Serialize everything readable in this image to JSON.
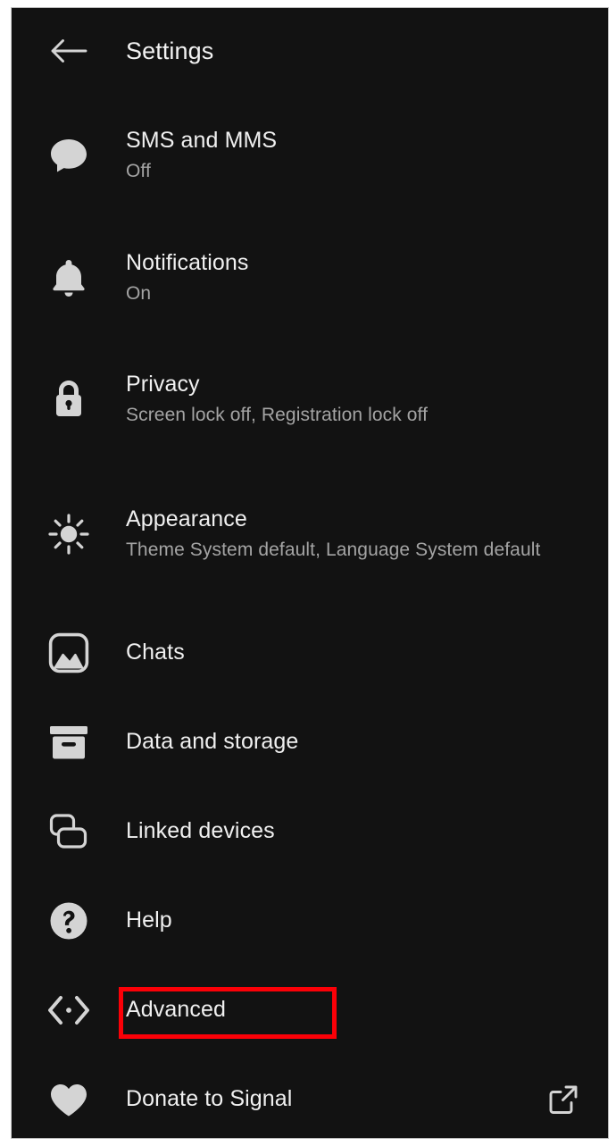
{
  "app": "Signal",
  "header": {
    "title": "Settings",
    "back_icon": "arrow-left-icon"
  },
  "theme": {
    "background": "#121212",
    "title_color": "#f0f0f0",
    "subtitle_color": "#a4a4a4",
    "icon_color": "#d4d4d4",
    "highlight_color": "#fb0007"
  },
  "highlight": {
    "target": "Advanced",
    "color": "#fb0007"
  },
  "settings": {
    "items": [
      {
        "id": "sms-and-mms",
        "label": "SMS and MMS",
        "value": "Off",
        "icon": "chat-bubble-icon",
        "trailing": null
      },
      {
        "id": "notifications",
        "label": "Notifications",
        "value": "On",
        "icon": "bell-icon",
        "trailing": null
      },
      {
        "id": "privacy",
        "label": "Privacy",
        "value": "Screen lock off, Registration lock off",
        "icon": "lock-icon",
        "trailing": null
      },
      {
        "id": "appearance",
        "label": "Appearance",
        "value": "Theme System default, Language System default",
        "icon": "sun-icon",
        "trailing": null
      },
      {
        "id": "chats",
        "label": "Chats",
        "value": null,
        "icon": "image-icon",
        "trailing": null
      },
      {
        "id": "data-and-storage",
        "label": "Data and storage",
        "value": null,
        "icon": "archive-box-icon",
        "trailing": null
      },
      {
        "id": "linked-devices",
        "label": "Linked devices",
        "value": null,
        "icon": "linked-devices-icon",
        "trailing": null
      },
      {
        "id": "help",
        "label": "Help",
        "value": null,
        "icon": "question-circle-icon",
        "trailing": null
      },
      {
        "id": "advanced",
        "label": "Advanced",
        "value": null,
        "icon": "code-brackets-icon",
        "trailing": null
      },
      {
        "id": "donate-to-signal",
        "label": "Donate to Signal",
        "value": null,
        "icon": "heart-icon",
        "trailing": "external-link-icon"
      }
    ]
  }
}
